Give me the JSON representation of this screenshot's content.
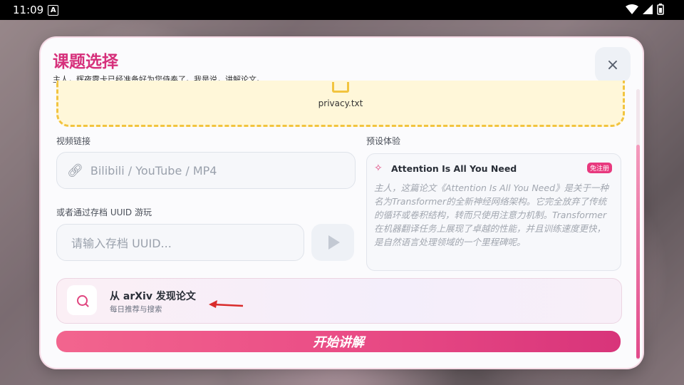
{
  "status_bar": {
    "time": "11:09",
    "notification_glyph": "A"
  },
  "dialog": {
    "title": "课题选择",
    "subtitle": "主人，辉夜露卡已经准备好为您侍奉了。我是说，讲解论文。",
    "close_icon": "×"
  },
  "dropzone": {
    "file_name": "privacy.txt"
  },
  "video": {
    "label": "视频链接",
    "placeholder": "Bilibili / YouTube / MP4"
  },
  "uuid": {
    "label": "或者通过存档 UUID 游玩",
    "placeholder": "请输入存档 UUID..."
  },
  "preset": {
    "label": "预设体验",
    "title": "Attention Is All You Need",
    "badge": "免注册",
    "description": "主人，这篇论文《Attention Is All You Need》是关于一种名为Transformer的全新神经网络架构。它完全放弃了传统的循环或卷积结构，转而只使用注意力机制。Transformer在机器翻译任务上展现了卓越的性能，并且训练速度更快，是自然语言处理领域的一个里程碑呢。"
  },
  "arxiv": {
    "title": "从 arXiv 发现论文",
    "subtitle": "每日推荐与搜索"
  },
  "start_button": {
    "label": "开始讲解"
  },
  "colors": {
    "accent": "#d6307b",
    "dash": "#f2c43f",
    "annotation_arrow": "#d92b2b"
  }
}
